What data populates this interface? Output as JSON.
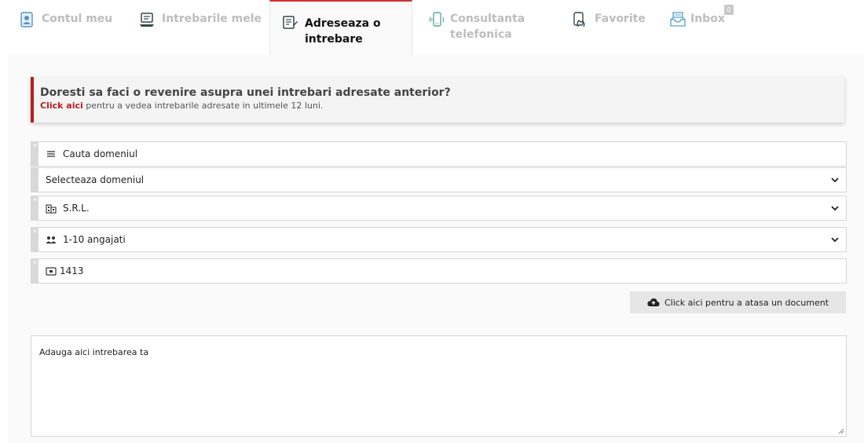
{
  "tabs": [
    {
      "label": "Contul meu",
      "icon": "account-icon",
      "active": false
    },
    {
      "label": "Intrebarile mele",
      "icon": "laptop-icon",
      "active": false
    },
    {
      "label": "Adreseaza o intrebare",
      "icon": "ask-question-icon",
      "active": true
    },
    {
      "label": "Consultanta telefonica",
      "icon": "phone-icon",
      "active": false
    },
    {
      "label": "Favorite",
      "icon": "favorite-hand-icon",
      "active": false
    },
    {
      "label": "Inbox",
      "icon": "inbox-icon",
      "active": false,
      "badge": "0"
    }
  ],
  "notice": {
    "title": "Doresti sa faci o revenire asupra unei intrebari adresate anterior?",
    "link_text": "Click aici",
    "rest_text": " pentru a vedea intrebarile adresate in ultimele 12 luni."
  },
  "form": {
    "search_placeholder": "Cauta domeniul",
    "domain_select": "Selecteaza domeniul",
    "company_type": "S.R.L.",
    "employees": "1-10 angajati",
    "caen_code": "1413",
    "required_marker": "*",
    "upload_label": "Click aici pentru a atasa un document",
    "question_placeholder": "Adauga aici intrebarea ta"
  },
  "colors": {
    "accent": "#b71c1c",
    "tab_inactive": "#bdbdbd",
    "panel_bg": "#fafafa"
  }
}
